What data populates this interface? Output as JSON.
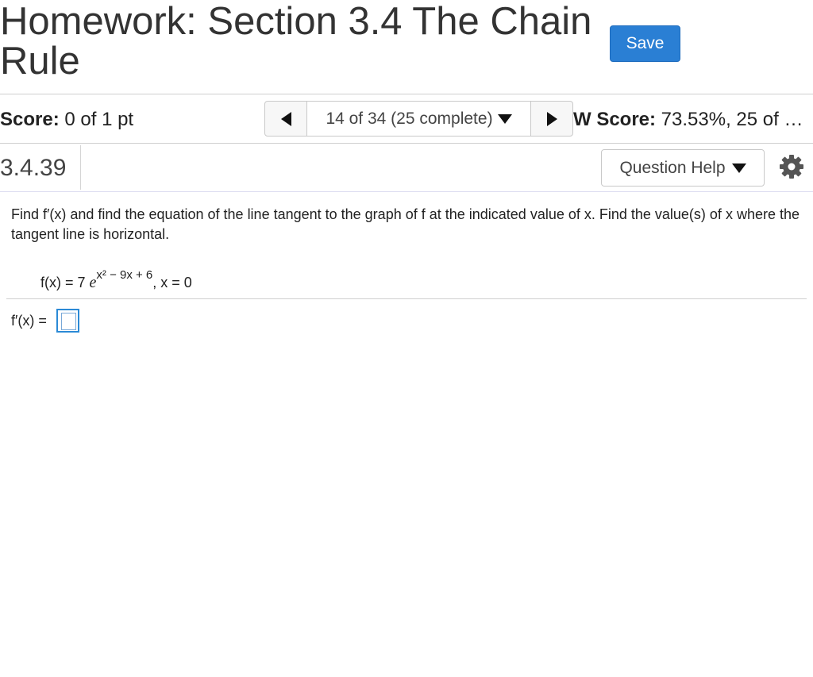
{
  "header": {
    "title": "Homework: Section 3.4 The Chain Rule",
    "save_label": "Save"
  },
  "status_bar": {
    "score_label": "Score:",
    "score_value": " 0 of 1 pt",
    "nav_position": "14 of 34 (25 complete)",
    "hw_score_label": "W Score:",
    "hw_score_value": " 73.53%, 25 of …"
  },
  "question": {
    "number": "3.4.39",
    "help_label": "Question Help",
    "prompt": "Find f′(x) and find the equation of the line tangent to the graph of f at the indicated value of x. Find the value(s) of x where the tangent line is horizontal.",
    "formula_lhs": "f(x) = 7 ",
    "formula_e": "e",
    "formula_exponent": "x² − 9x + 6",
    "formula_point": ",  x = 0",
    "answer_label": "f′(x) ="
  },
  "icons": {
    "prev": "triangle-left-icon",
    "next": "triangle-right-icon",
    "dropdown": "triangle-down-icon",
    "settings": "gear-icon"
  },
  "colors": {
    "save_button": "#2a7fd4",
    "answer_border": "#2b8ad6"
  }
}
